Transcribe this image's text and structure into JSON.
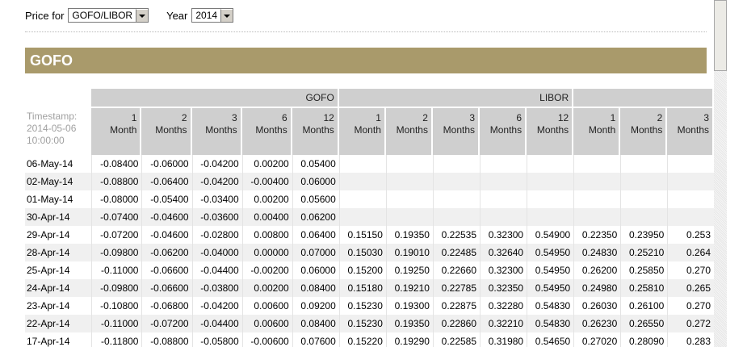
{
  "controls": {
    "price_for_label": "Price for",
    "price_for_value": "GOFO/LIBOR",
    "year_label": "Year",
    "year_value": "2014"
  },
  "section_title": "GOFO",
  "table": {
    "timestamp": "Timestamp: 2014-05-06 10:00:00",
    "group_headers": {
      "gofo": "GOFO",
      "libor": "LIBOR"
    },
    "columns": [
      "1\nMonth",
      "2\nMonths",
      "3\nMonths",
      "6\nMonths",
      "12\nMonths",
      "1\nMonth",
      "2\nMonths",
      "3\nMonths",
      "6\nMonths",
      "12\nMonths",
      "1\nMonth",
      "2\nMonths",
      "3\nMonths"
    ],
    "rows": [
      {
        "date": "06-May-14",
        "values": [
          "-0.08400",
          "-0.06000",
          "-0.04200",
          "0.00200",
          "0.05400",
          "",
          "",
          "",
          "",
          "",
          "",
          "",
          ""
        ]
      },
      {
        "date": "02-May-14",
        "values": [
          "-0.08800",
          "-0.06400",
          "-0.04200",
          "-0.00400",
          "0.06000",
          "",
          "",
          "",
          "",
          "",
          "",
          "",
          ""
        ]
      },
      {
        "date": "01-May-14",
        "values": [
          "-0.08000",
          "-0.05400",
          "-0.03400",
          "0.00200",
          "0.05600",
          "",
          "",
          "",
          "",
          "",
          "",
          "",
          ""
        ]
      },
      {
        "date": "30-Apr-14",
        "values": [
          "-0.07400",
          "-0.04600",
          "-0.03600",
          "0.00400",
          "0.06200",
          "",
          "",
          "",
          "",
          "",
          "",
          "",
          ""
        ]
      },
      {
        "date": "29-Apr-14",
        "values": [
          "-0.07200",
          "-0.04600",
          "-0.02800",
          "0.00800",
          "0.06400",
          "0.15150",
          "0.19350",
          "0.22535",
          "0.32300",
          "0.54900",
          "0.22350",
          "0.23950",
          "0.253"
        ]
      },
      {
        "date": "28-Apr-14",
        "values": [
          "-0.09800",
          "-0.06200",
          "-0.04000",
          "0.00000",
          "0.07000",
          "0.15030",
          "0.19010",
          "0.22485",
          "0.32640",
          "0.54950",
          "0.24830",
          "0.25210",
          "0.264"
        ]
      },
      {
        "date": "25-Apr-14",
        "values": [
          "-0.11000",
          "-0.06600",
          "-0.04400",
          "-0.00200",
          "0.06000",
          "0.15200",
          "0.19250",
          "0.22660",
          "0.32300",
          "0.54950",
          "0.26200",
          "0.25850",
          "0.270"
        ]
      },
      {
        "date": "24-Apr-14",
        "values": [
          "-0.09800",
          "-0.06600",
          "-0.03800",
          "0.00200",
          "0.08400",
          "0.15180",
          "0.19210",
          "0.22785",
          "0.32350",
          "0.54950",
          "0.24980",
          "0.25810",
          "0.265"
        ]
      },
      {
        "date": "23-Apr-14",
        "values": [
          "-0.10800",
          "-0.06800",
          "-0.04200",
          "0.00600",
          "0.09200",
          "0.15230",
          "0.19300",
          "0.22875",
          "0.32280",
          "0.54830",
          "0.26030",
          "0.26100",
          "0.270"
        ]
      },
      {
        "date": "22-Apr-14",
        "values": [
          "-0.11000",
          "-0.07200",
          "-0.04400",
          "0.00600",
          "0.08400",
          "0.15230",
          "0.19350",
          "0.22860",
          "0.32210",
          "0.54830",
          "0.26230",
          "0.26550",
          "0.272"
        ]
      },
      {
        "date": "17-Apr-14",
        "values": [
          "-0.11800",
          "-0.08800",
          "-0.05800",
          "-0.00600",
          "0.07600",
          "0.15220",
          "0.19290",
          "0.22585",
          "0.31980",
          "0.54650",
          "0.27020",
          "0.28090",
          "0.283"
        ]
      }
    ]
  }
}
